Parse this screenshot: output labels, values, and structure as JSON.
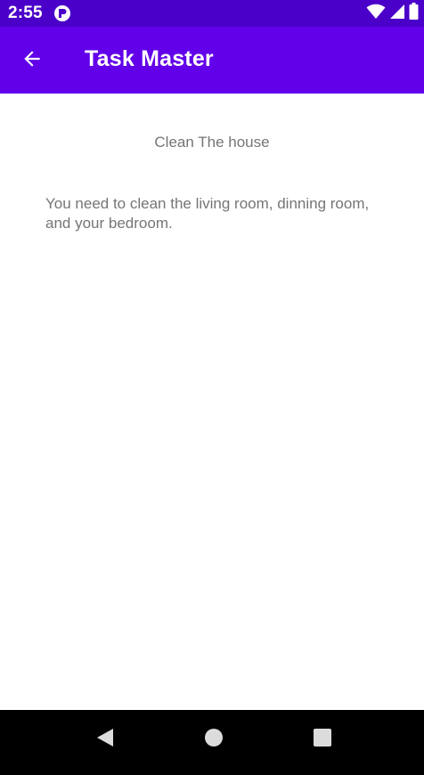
{
  "status_bar": {
    "time": "2:55",
    "icons": [
      "app-notification-icon",
      "wifi-icon",
      "signal-icon",
      "battery-icon"
    ]
  },
  "app_bar": {
    "title": "Task Master",
    "back_icon": "arrow-back-icon"
  },
  "task": {
    "title": "Clean The house",
    "description": "You need to clean the living room, dinning room, and your bedroom."
  },
  "nav_bar": {
    "icons": [
      "nav-back-icon",
      "nav-home-icon",
      "nav-recents-icon"
    ]
  },
  "colors": {
    "status_bar": "#4a00c8",
    "app_bar": "#6200ea",
    "text_secondary": "#757575",
    "nav_bar": "#000000"
  }
}
